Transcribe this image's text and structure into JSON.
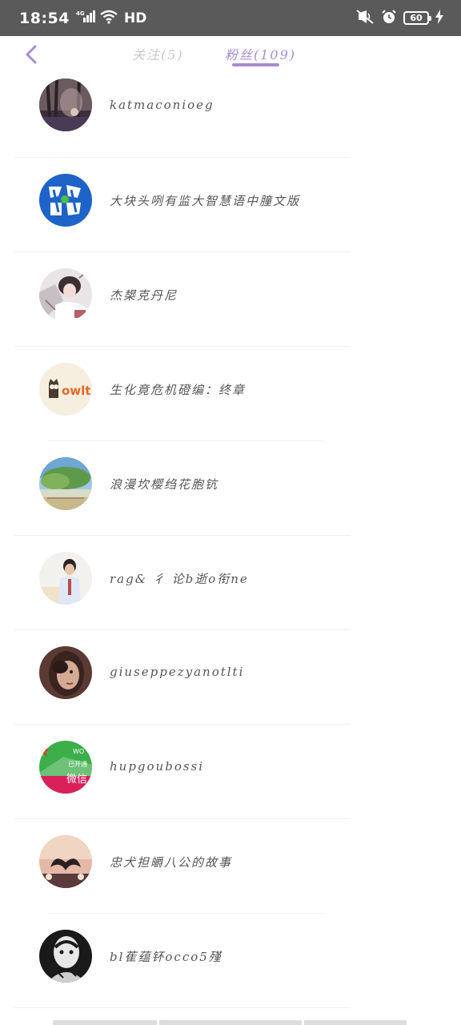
{
  "status_bar": {
    "time": "18:54",
    "network": "4G",
    "hd": "HD",
    "battery": "60",
    "icons": [
      "signal-icon",
      "wifi-icon",
      "mute-icon",
      "alarm-icon",
      "battery-icon",
      "charging-icon"
    ]
  },
  "header": {
    "back_icon": "chevron-left-icon",
    "tabs": [
      {
        "label": "关注(5)",
        "active": false
      },
      {
        "label": "粉丝(109)",
        "active": true
      }
    ],
    "accent_color": "#a88bd3"
  },
  "fans": [
    {
      "name": "katmaconioeg"
    },
    {
      "name": "大块头咧有监大智慧语中朣文版"
    },
    {
      "name": "杰槼克丹尼"
    },
    {
      "name": "生化竟危机磴编：终章"
    },
    {
      "name": "浪漫坎樱绉花胞钪"
    },
    {
      "name": "rag& 彳 论b逝o衔ne"
    },
    {
      "name": "giuseppezyanotlti"
    },
    {
      "name": "hupgoubossi"
    },
    {
      "name": "忠犬担皭八公的故事"
    },
    {
      "name": "bl萑蕴钚occo5殣"
    }
  ],
  "avatar_texts": {
    "owlt": "owlt",
    "wechat_small": "WO",
    "wechat_line1": "已开通",
    "wechat_line2": "微信"
  }
}
